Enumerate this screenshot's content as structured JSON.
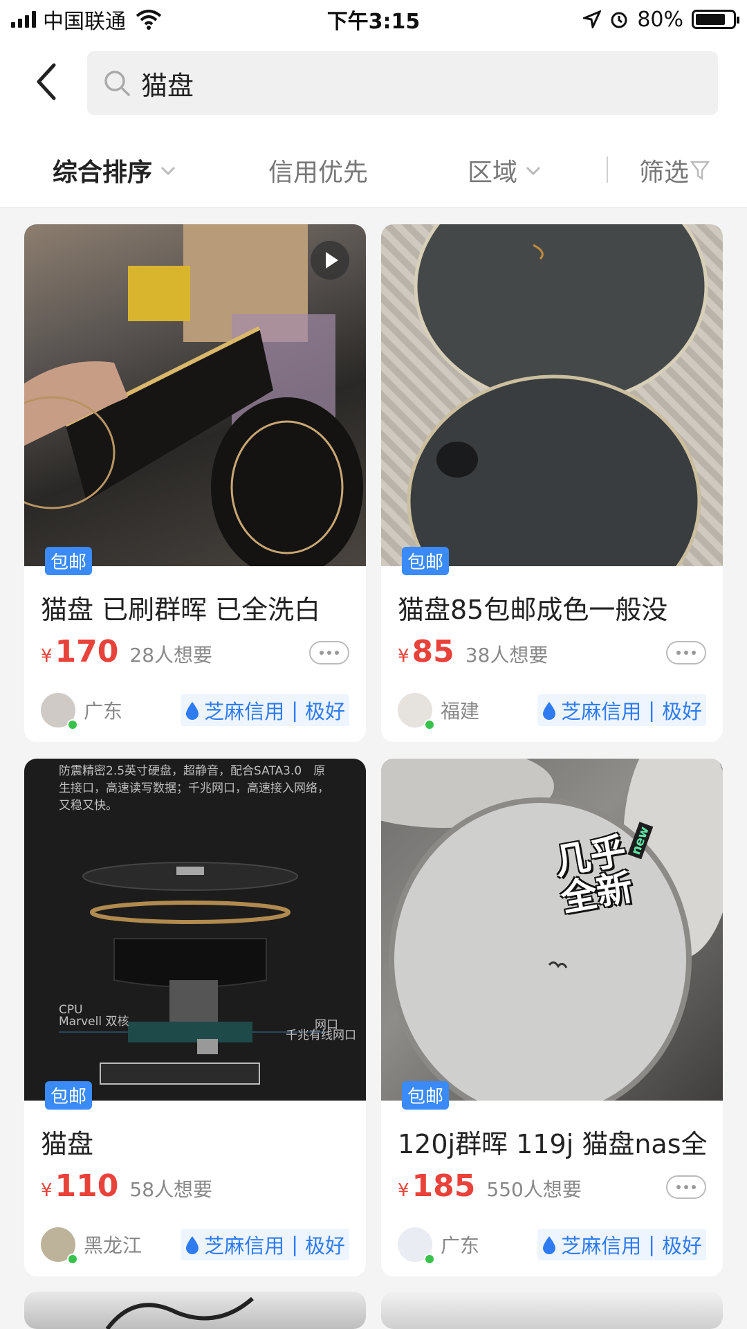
{
  "status_bar": {
    "carrier": "中国联通",
    "time": "下午3:15",
    "battery": "80%",
    "battery_level": 0.8
  },
  "search": {
    "query": "猫盘"
  },
  "filters": {
    "items": [
      {
        "label": "综合排序",
        "has_chevron": true
      },
      {
        "label": "信用优先"
      },
      {
        "label": "区域",
        "has_chevron": true
      },
      {
        "label": "筛选",
        "has_filter_icon": true
      }
    ]
  },
  "listings": [
    {
      "badge": "包邮",
      "title": "猫盘 已刷群晖 已全洗白",
      "currency": "¥",
      "price": "170",
      "wants": "28人想要",
      "location": "广东",
      "credit_label": "芝麻信用",
      "credit_level": "极好",
      "has_video": true
    },
    {
      "badge": "包邮",
      "title": "猫盘85包邮成色一般没",
      "currency": "¥",
      "price": "85",
      "wants": "38人想要",
      "location": "福建",
      "credit_label": "芝麻信用",
      "credit_level": "极好"
    },
    {
      "badge": "包邮",
      "title": "猫盘",
      "currency": "¥",
      "price": "110",
      "wants": "58人想要",
      "location": "黑龙江",
      "credit_label": "芝麻信用",
      "credit_level": "极好",
      "image_text": {
        "description": "防震精密2.5英寸硬盘，超静音，配合SATA3.0　原生接口，高速读写数据；千兆网口，高速接入网络，又稳又快。",
        "cpu_label": "CPU",
        "cpu_value": "Marvell 双核",
        "port_label": "网口",
        "port_value": "千兆有线网口"
      }
    },
    {
      "badge": "包邮",
      "title": "120j群晖 119j 猫盘nas全",
      "currency": "¥",
      "price": "185",
      "wants": "550人想要",
      "location": "广东",
      "credit_label": "芝麻信用",
      "credit_level": "极好",
      "sticker_main": "几乎全新",
      "sticker_sub": "new"
    }
  ],
  "colors": {
    "price_red": "#e8423a",
    "credit_blue": "#2e7bf2",
    "badge_blue": "#3a8af7"
  }
}
